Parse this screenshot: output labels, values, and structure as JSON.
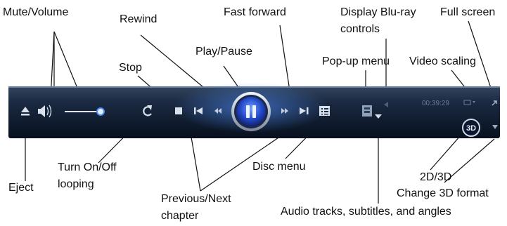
{
  "diagram": {
    "labels": {
      "mute_volume": "Mute/Volume",
      "rewind": "Rewind",
      "fast_forward": "Fast forward",
      "display_bluray_1": "Display Blu-ray",
      "display_bluray_2": "controls",
      "full_screen": "Full screen",
      "play_pause": "Play/Pause",
      "popup_menu": "Pop-up menu",
      "video_scaling": "Video scaling",
      "stop": "Stop",
      "eject": "Eject",
      "turn_looping_1": "Turn On/Off",
      "turn_looping_2": "looping",
      "disc_menu": "Disc menu",
      "two_d_three_d": "2D/3D",
      "change_3d_format": "Change 3D format",
      "prev_next_1": "Previous/Next",
      "prev_next_2": "chapter",
      "audio_tracks": "Audio tracks, subtitles, and angles"
    }
  },
  "player": {
    "time": "00:39:29",
    "three_d_button": "3D",
    "icons": [
      "eject-icon",
      "volume-icon",
      "volume-slider",
      "loop-icon",
      "stop-icon",
      "previous-chapter-icon",
      "rewind-icon",
      "play-pause-icon",
      "fast-forward-icon",
      "next-chapter-icon",
      "disc-menu-icon",
      "popup-menu-icon",
      "audio-tracks-icon",
      "bluray-controls-arrow-icon",
      "video-scaling-icon",
      "full-screen-icon",
      "three-d-button",
      "change-3d-format-icon"
    ],
    "colors": {
      "bar_dark": "#0a1424",
      "bar_mid": "#1d2f4c",
      "accent_glow": "#5aa0ff",
      "button_blue": "#2a5bd6"
    }
  }
}
